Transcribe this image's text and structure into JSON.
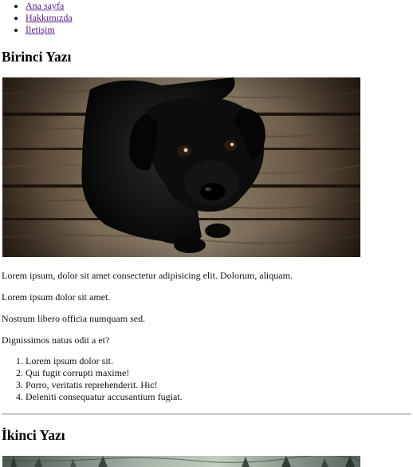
{
  "nav": {
    "items": [
      {
        "label": "Ana sayfa"
      },
      {
        "label": "Hakkımızda"
      },
      {
        "label": "İletişim"
      }
    ]
  },
  "post1": {
    "title": "Birinci Yazı",
    "image_icon": "black-puppy-photo",
    "paragraphs": [
      "Lorem ipsum, dolor sit amet consectetur adipisicing elit. Dolorum, aliquam.",
      "Lorem ipsum dolor sit amet.",
      "Nostrum libero officia numquam sed.",
      "Dignissimos natus odit a et?"
    ],
    "list": [
      "Lorem ipsum dolor sit.",
      "Qui fugit corrupti maxime!",
      "Porro, veritatis reprehenderit. Hic!",
      "Deleniti consequatur accusantium fugiat."
    ]
  },
  "post2": {
    "title": "İkinci Yazı",
    "image_icon": "forest-photo"
  },
  "colors": {
    "link": "#551a8b",
    "text": "#111111"
  }
}
